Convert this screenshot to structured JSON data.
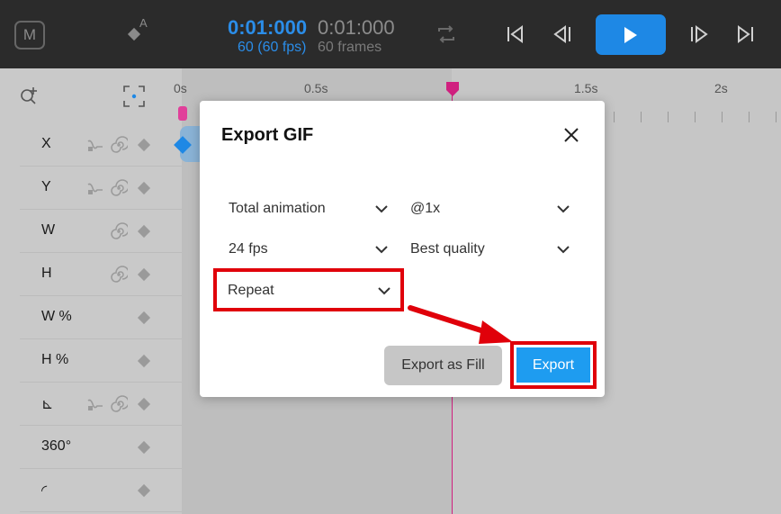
{
  "topbar": {
    "mode_button": "M",
    "auto_key_letter": "A",
    "current_time": "0:01:000",
    "total_time": "0:01:000",
    "fps_label": "60 (60 fps)",
    "frames_label": "60 frames"
  },
  "properties": [
    {
      "label": "X"
    },
    {
      "label": "Y"
    },
    {
      "label": "W"
    },
    {
      "label": "H"
    },
    {
      "label": "W %"
    },
    {
      "label": "H %"
    },
    {
      "label": "⊾"
    },
    {
      "label": "360°"
    },
    {
      "label": "◜"
    }
  ],
  "ruler": {
    "labels": [
      "0s",
      "0.5s",
      "1.5s",
      "2s"
    ]
  },
  "dialog": {
    "title": "Export GIF",
    "range_select": "Total animation",
    "scale_select": "@1x",
    "fps_select": "24 fps",
    "quality_select": "Best quality",
    "loop_select": "Repeat",
    "export_as_fill": "Export as Fill",
    "export": "Export"
  },
  "colors": {
    "accent": "#1e88e5",
    "highlight": "#e0000a",
    "playhead": "#d0207f"
  }
}
